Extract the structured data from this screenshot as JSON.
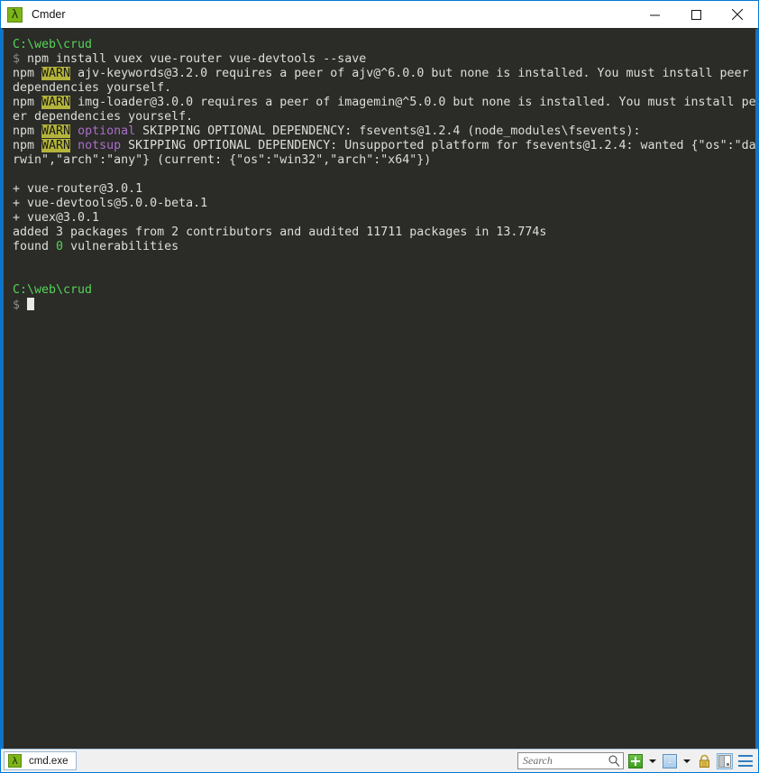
{
  "window": {
    "title": "Cmder",
    "icon": "lambda-icon",
    "accent_color": "#0078d7",
    "controls": {
      "minimize": "minimize-button",
      "maximize": "maximize-button",
      "close": "close-button"
    }
  },
  "terminal": {
    "background_color": "#2b2b28",
    "border_color": "#1f6fb2",
    "cursor": "block-cursor",
    "lines": [
      {
        "segments": [
          {
            "text": "C:\\web\\crud",
            "color": "green"
          }
        ]
      },
      {
        "segments": [
          {
            "text": "$ ",
            "color": "gray"
          },
          {
            "text": "npm install vuex vue-router vue-devtools --save",
            "color": "white"
          }
        ]
      },
      {
        "segments": [
          {
            "text": "npm ",
            "color": "white"
          },
          {
            "text": "WARN",
            "color": "warn"
          },
          {
            "text": " ajv-keywords@3.2.0 requires a peer of ajv@^6.0.0 but none is installed. You must install peer",
            "color": "white"
          }
        ]
      },
      {
        "segments": [
          {
            "text": "dependencies yourself.",
            "color": "white"
          }
        ]
      },
      {
        "segments": [
          {
            "text": "npm ",
            "color": "white"
          },
          {
            "text": "WARN",
            "color": "warn"
          },
          {
            "text": " img-loader@3.0.0 requires a peer of imagemin@^5.0.0 but none is installed. You must install pe",
            "color": "white"
          }
        ]
      },
      {
        "segments": [
          {
            "text": "er dependencies yourself.",
            "color": "white"
          }
        ]
      },
      {
        "segments": [
          {
            "text": "npm ",
            "color": "white"
          },
          {
            "text": "WARN",
            "color": "warn"
          },
          {
            "text": " ",
            "color": "white"
          },
          {
            "text": "optional",
            "color": "purple"
          },
          {
            "text": " SKIPPING OPTIONAL DEPENDENCY: fsevents@1.2.4 (node_modules\\fsevents):",
            "color": "white"
          }
        ]
      },
      {
        "segments": [
          {
            "text": "npm ",
            "color": "white"
          },
          {
            "text": "WARN",
            "color": "warn"
          },
          {
            "text": " ",
            "color": "white"
          },
          {
            "text": "notsup",
            "color": "purple"
          },
          {
            "text": " SKIPPING OPTIONAL DEPENDENCY: Unsupported platform for fsevents@1.2.4: wanted {\"os\":\"da",
            "color": "white"
          }
        ]
      },
      {
        "segments": [
          {
            "text": "rwin\",\"arch\":\"any\"} (current: {\"os\":\"win32\",\"arch\":\"x64\"})",
            "color": "white"
          }
        ]
      },
      {
        "segments": []
      },
      {
        "segments": [
          {
            "text": "+ vue-router@3.0.1",
            "color": "white"
          }
        ]
      },
      {
        "segments": [
          {
            "text": "+ vue-devtools@5.0.0-beta.1",
            "color": "white"
          }
        ]
      },
      {
        "segments": [
          {
            "text": "+ vuex@3.0.1",
            "color": "white"
          }
        ]
      },
      {
        "segments": [
          {
            "text": "added 3 packages from 2 contributors and audited 11711 packages in 13.774s",
            "color": "white"
          }
        ]
      },
      {
        "segments": [
          {
            "text": "found ",
            "color": "white"
          },
          {
            "text": "0",
            "color": "green"
          },
          {
            "text": " vulnerabilities",
            "color": "white"
          }
        ]
      },
      {
        "segments": []
      },
      {
        "segments": []
      },
      {
        "segments": [
          {
            "text": "C:\\web\\crud",
            "color": "green"
          }
        ]
      },
      {
        "segments": [
          {
            "text": "$ ",
            "color": "gray"
          }
        ],
        "cursor": true
      }
    ]
  },
  "statusbar": {
    "tab": {
      "label": "cmd.exe",
      "icon": "lambda-icon"
    },
    "search": {
      "placeholder": "Search",
      "value": "",
      "icon": "magnifier-icon"
    },
    "buttons": {
      "new_console": "plus-icon",
      "new_console_dropdown": "chevron-down-icon",
      "active_console_number": "1",
      "console_dropdown": "chevron-down-icon",
      "lock": "padlock-icon",
      "panels": "split-panel-icon",
      "menu": "hamburger-icon"
    }
  }
}
